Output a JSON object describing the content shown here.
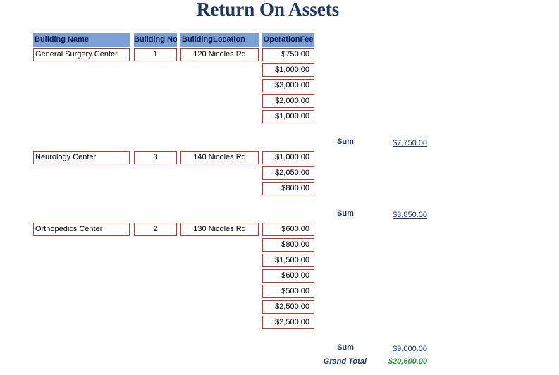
{
  "title": "Return On Assets",
  "headers": {
    "name": "Building Name",
    "no": "Building No",
    "location": "BuildingLocation",
    "fee": "OperationFee"
  },
  "groups": [
    {
      "name": "General Surgery Center",
      "no": "1",
      "location": "120 Nicoles Rd",
      "fees": [
        "$750.00",
        "$1,000.00",
        "$3,000.00",
        "$2,000.00",
        "$1,000.00"
      ],
      "sum_label": "Sum",
      "sum": "$7,750.00"
    },
    {
      "name": "Neurology Center",
      "no": "3",
      "location": "140 Nicoles Rd",
      "fees": [
        "$1,000.00",
        "$2,050.00",
        "$800.00"
      ],
      "sum_label": "Sum",
      "sum": "$3,850.00"
    },
    {
      "name": "Orthopedics Center",
      "no": "2",
      "location": "130 Nicoles Rd",
      "fees": [
        "$600.00",
        "$800.00",
        "$1,500.00",
        "$600.00",
        "$500.00",
        "$2,500.00",
        "$2,500.00"
      ],
      "sum_label": "Sum",
      "sum": "$9,000.00"
    }
  ],
  "grand_total": {
    "label": "Grand Total",
    "value": "$20,600.00"
  }
}
